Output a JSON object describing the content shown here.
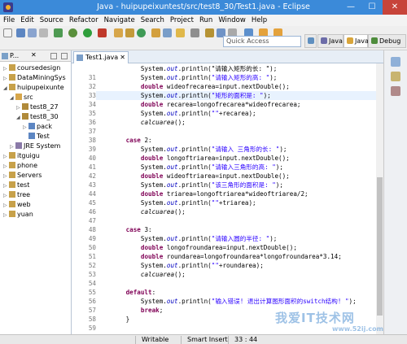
{
  "window": {
    "title": "Java - huipupeixuntest/src/test8_30/Test1.java - Eclipse",
    "minimize_label": "—",
    "maximize_label": "☐",
    "close_label": "✕"
  },
  "menu": [
    "File",
    "Edit",
    "Source",
    "Refactor",
    "Navigate",
    "Search",
    "Project",
    "Run",
    "Window",
    "Help"
  ],
  "toolbar": {
    "quick_access_placeholder": "Quick Access",
    "perspectives": [
      {
        "label": "",
        "icon": "debug-perspective-icon",
        "color": "#5f8fbf"
      },
      {
        "label": "Java EE",
        "icon": "javaee-perspective-icon",
        "color": "#6c6ca8"
      },
      {
        "label": "Java",
        "icon": "java-perspective-icon",
        "color": "#d9a53a"
      },
      {
        "label": "Debug",
        "icon": "bug-icon",
        "color": "#4e8c3c"
      }
    ]
  },
  "explorer": {
    "tab_label": "P...",
    "close_label": "✕",
    "items": [
      {
        "label": "coursedesign",
        "indent": 1,
        "arrow": "▷",
        "icon": "project-icon"
      },
      {
        "label": "DataMiningSys",
        "indent": 1,
        "arrow": "▷",
        "icon": "project-icon"
      },
      {
        "label": "huipupeixunte",
        "indent": 1,
        "arrow": "◢",
        "icon": "project-icon"
      },
      {
        "label": "src",
        "indent": 2,
        "arrow": "◢",
        "icon": "source-folder-icon"
      },
      {
        "label": "test8_27",
        "indent": 3,
        "arrow": "▷",
        "icon": "package-icon"
      },
      {
        "label": "test8_30",
        "indent": 3,
        "arrow": "◢",
        "icon": "package-icon"
      },
      {
        "label": "pack",
        "indent": 4,
        "arrow": "▷",
        "icon": "java-file-icon"
      },
      {
        "label": "Test",
        "indent": 4,
        "arrow": "",
        "icon": "java-file-icon"
      },
      {
        "label": "JRE System",
        "indent": 2,
        "arrow": "▷",
        "icon": "library-icon"
      },
      {
        "label": "itguigu",
        "indent": 1,
        "arrow": "▷",
        "icon": "project-icon"
      },
      {
        "label": "phone",
        "indent": 1,
        "arrow": "▷",
        "icon": "project-icon"
      },
      {
        "label": "Servers",
        "indent": 1,
        "arrow": "▷",
        "icon": "project-icon"
      },
      {
        "label": "test",
        "indent": 1,
        "arrow": "▷",
        "icon": "project-icon"
      },
      {
        "label": "tree",
        "indent": 1,
        "arrow": "▷",
        "icon": "project-icon"
      },
      {
        "label": "web",
        "indent": 1,
        "arrow": "▷",
        "icon": "project-icon"
      },
      {
        "label": "yuan",
        "indent": 1,
        "arrow": "▷",
        "icon": "project-icon"
      }
    ]
  },
  "editor": {
    "tab_label": "Test1.java",
    "tab_close": "✕",
    "current_line_index": 3,
    "lines": [
      {
        "num": "",
        "code": [
          {
            "t": "            System.",
            "c": ""
          },
          {
            "t": "out",
            "c": "fld"
          },
          {
            "t": ".println(\"请输入矩形的长: \");",
            "c": ""
          }
        ]
      },
      {
        "num": "31",
        "code": [
          {
            "t": "            System.",
            "c": ""
          },
          {
            "t": "out",
            "c": "fld"
          },
          {
            "t": ".println(",
            "c": ""
          },
          {
            "t": "\"请输入矩形的高: \"",
            "c": "str"
          },
          {
            "t": ");",
            "c": ""
          }
        ]
      },
      {
        "num": "32",
        "code": [
          {
            "t": "            ",
            "c": ""
          },
          {
            "t": "double",
            "c": "kw"
          },
          {
            "t": " wideofrecarea=input.nextDouble();",
            "c": ""
          }
        ]
      },
      {
        "num": "33",
        "code": [
          {
            "t": "            System.",
            "c": ""
          },
          {
            "t": "out",
            "c": "fld"
          },
          {
            "t": ".println(",
            "c": ""
          },
          {
            "t": "\"矩形的面积是: \"",
            "c": "str"
          },
          {
            "t": ");",
            "c": ""
          }
        ]
      },
      {
        "num": "34",
        "code": [
          {
            "t": "            ",
            "c": ""
          },
          {
            "t": "double",
            "c": "kw"
          },
          {
            "t": " recarea=longofrecarea*wideofrecarea;",
            "c": ""
          }
        ]
      },
      {
        "num": "35",
        "code": [
          {
            "t": "            System.",
            "c": ""
          },
          {
            "t": "out",
            "c": "fld"
          },
          {
            "t": ".println(",
            "c": ""
          },
          {
            "t": "\"\"",
            "c": "str"
          },
          {
            "t": "+recarea);",
            "c": ""
          }
        ]
      },
      {
        "num": "36",
        "code": [
          {
            "t": "            ",
            "c": ""
          },
          {
            "t": "calcuarea",
            "c": "mi"
          },
          {
            "t": "();",
            "c": ""
          }
        ]
      },
      {
        "num": "37",
        "code": [
          {
            "t": "",
            "c": ""
          }
        ]
      },
      {
        "num": "38",
        "code": [
          {
            "t": "        ",
            "c": ""
          },
          {
            "t": "case",
            "c": "kw"
          },
          {
            "t": " 2:",
            "c": ""
          }
        ]
      },
      {
        "num": "39",
        "code": [
          {
            "t": "            System.",
            "c": ""
          },
          {
            "t": "out",
            "c": "fld"
          },
          {
            "t": ".println(",
            "c": ""
          },
          {
            "t": "\"请输入 三角形的长: \"",
            "c": "str"
          },
          {
            "t": ");",
            "c": ""
          }
        ]
      },
      {
        "num": "40",
        "code": [
          {
            "t": "            ",
            "c": ""
          },
          {
            "t": "double",
            "c": "kw"
          },
          {
            "t": " longoftriarea=input.nextDouble();",
            "c": ""
          }
        ]
      },
      {
        "num": "41",
        "code": [
          {
            "t": "            System.",
            "c": ""
          },
          {
            "t": "out",
            "c": "fld"
          },
          {
            "t": ".println(",
            "c": ""
          },
          {
            "t": "\"请输入三角形的高: \"",
            "c": "str"
          },
          {
            "t": ");",
            "c": ""
          }
        ]
      },
      {
        "num": "42",
        "code": [
          {
            "t": "            ",
            "c": ""
          },
          {
            "t": "double",
            "c": "kw"
          },
          {
            "t": " wideoftriarea=input.nextDouble();",
            "c": ""
          }
        ]
      },
      {
        "num": "43",
        "code": [
          {
            "t": "            System.",
            "c": ""
          },
          {
            "t": "out",
            "c": "fld"
          },
          {
            "t": ".println(",
            "c": ""
          },
          {
            "t": "\"该三角形的面积是: \"",
            "c": "str"
          },
          {
            "t": ");",
            "c": ""
          }
        ]
      },
      {
        "num": "44",
        "code": [
          {
            "t": "            ",
            "c": ""
          },
          {
            "t": "double",
            "c": "kw"
          },
          {
            "t": " triarea=longoftriarea*wideoftriarea/2;",
            "c": ""
          }
        ]
      },
      {
        "num": "45",
        "code": [
          {
            "t": "            System.",
            "c": ""
          },
          {
            "t": "out",
            "c": "fld"
          },
          {
            "t": ".println(",
            "c": ""
          },
          {
            "t": "\"\"",
            "c": "str"
          },
          {
            "t": "+triarea);",
            "c": ""
          }
        ]
      },
      {
        "num": "46",
        "code": [
          {
            "t": "            ",
            "c": ""
          },
          {
            "t": "calcuarea",
            "c": "mi"
          },
          {
            "t": "();",
            "c": ""
          }
        ]
      },
      {
        "num": "47",
        "code": [
          {
            "t": "",
            "c": ""
          }
        ]
      },
      {
        "num": "48",
        "code": [
          {
            "t": "        ",
            "c": ""
          },
          {
            "t": "case",
            "c": "kw"
          },
          {
            "t": " 3:",
            "c": ""
          }
        ]
      },
      {
        "num": "49",
        "code": [
          {
            "t": "            System.",
            "c": ""
          },
          {
            "t": "out",
            "c": "fld"
          },
          {
            "t": ".println(",
            "c": ""
          },
          {
            "t": "\"请输入圆的半径: \"",
            "c": "str"
          },
          {
            "t": ");",
            "c": ""
          }
        ]
      },
      {
        "num": "50",
        "code": [
          {
            "t": "            ",
            "c": ""
          },
          {
            "t": "double",
            "c": "kw"
          },
          {
            "t": " longofroundarea=input.nextDouble();",
            "c": ""
          }
        ]
      },
      {
        "num": "51",
        "code": [
          {
            "t": "            ",
            "c": ""
          },
          {
            "t": "double",
            "c": "kw"
          },
          {
            "t": " roundarea=longofroundarea*longofroundarea*3.14;",
            "c": ""
          }
        ]
      },
      {
        "num": "52",
        "code": [
          {
            "t": "            System.",
            "c": ""
          },
          {
            "t": "out",
            "c": "fld"
          },
          {
            "t": ".println(",
            "c": ""
          },
          {
            "t": "\"\"",
            "c": "str"
          },
          {
            "t": "+roundarea);",
            "c": ""
          }
        ]
      },
      {
        "num": "53",
        "code": [
          {
            "t": "            ",
            "c": ""
          },
          {
            "t": "calcuarea",
            "c": "mi"
          },
          {
            "t": "();",
            "c": ""
          }
        ]
      },
      {
        "num": "54",
        "code": [
          {
            "t": "",
            "c": ""
          }
        ]
      },
      {
        "num": "55",
        "code": [
          {
            "t": "        ",
            "c": ""
          },
          {
            "t": "default",
            "c": "kw"
          },
          {
            "t": ":",
            "c": ""
          }
        ]
      },
      {
        "num": "56",
        "code": [
          {
            "t": "            System.",
            "c": ""
          },
          {
            "t": "out",
            "c": "fld"
          },
          {
            "t": ".println(",
            "c": ""
          },
          {
            "t": "\"输入错误! 退出计算图形面积的switch结构! \"",
            "c": "str"
          },
          {
            "t": ");",
            "c": ""
          }
        ]
      },
      {
        "num": "57",
        "code": [
          {
            "t": "            ",
            "c": ""
          },
          {
            "t": "break",
            "c": "kw"
          },
          {
            "t": ";",
            "c": ""
          }
        ]
      },
      {
        "num": "58",
        "code": [
          {
            "t": "        }",
            "c": ""
          }
        ]
      },
      {
        "num": "59",
        "code": [
          {
            "t": "",
            "c": ""
          }
        ]
      }
    ]
  },
  "status": {
    "mode": "Writable",
    "insert": "Smart Insert",
    "position": "33 : 44"
  },
  "watermark": {
    "text": "我爱IT技术网",
    "sub": "www.52ij.com"
  }
}
